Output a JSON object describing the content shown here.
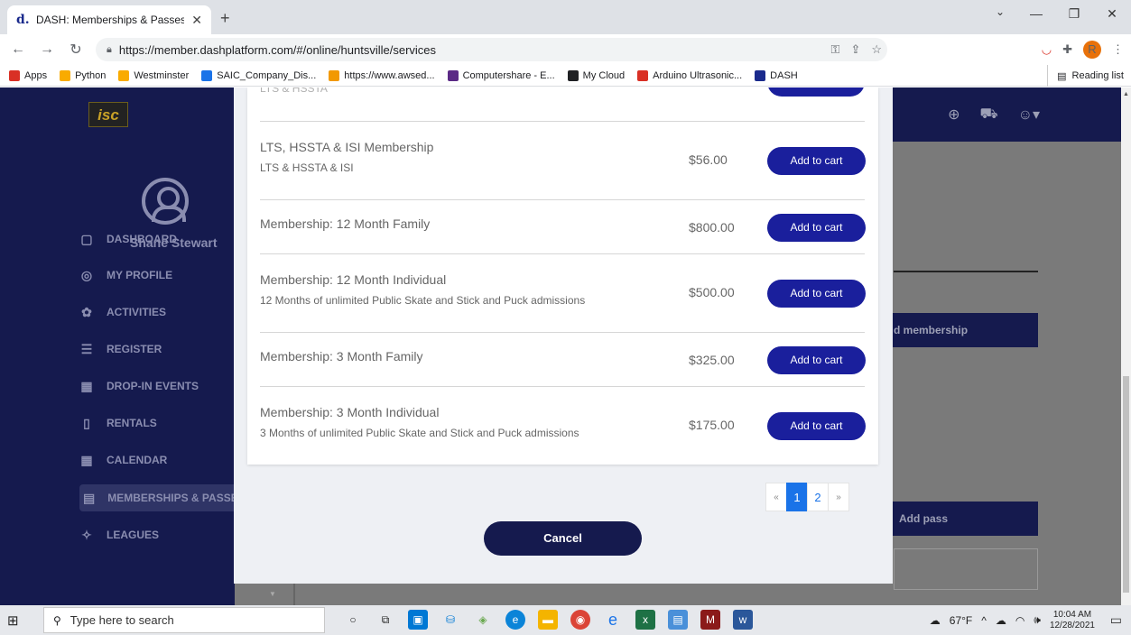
{
  "browser": {
    "tab_title": "DASH: Memberships & Passes",
    "url": "https://member.dashplatform.com/#/online/huntsville/services",
    "profile_initial": "R",
    "bookmarks": [
      {
        "label": "Apps",
        "color": "#d93025"
      },
      {
        "label": "Python",
        "color": "#f9ab00"
      },
      {
        "label": "Westminster",
        "color": "#f9ab00"
      },
      {
        "label": "SAIC_Company_Dis...",
        "color": "#1a73e8"
      },
      {
        "label": "https://www.awsed...",
        "color": "#f29900"
      },
      {
        "label": "Computershare - E...",
        "color": "#5b2a86"
      },
      {
        "label": "My Cloud",
        "color": "#202124"
      },
      {
        "label": "Arduino Ultrasonic...",
        "color": "#d93025"
      },
      {
        "label": "DASH",
        "color": "#1a2a8c"
      }
    ],
    "reading_list": "Reading list"
  },
  "app": {
    "logo": "isc",
    "user_name": "Shane Stewart",
    "menu": [
      {
        "label": "DASHBOARD",
        "icon": "▢"
      },
      {
        "label": "MY PROFILE",
        "icon": "◎"
      },
      {
        "label": "ACTIVITIES",
        "icon": "✿"
      },
      {
        "label": "REGISTER",
        "icon": "☰"
      },
      {
        "label": "DROP-IN EVENTS",
        "icon": "▦"
      },
      {
        "label": "RENTALS",
        "icon": "▯"
      },
      {
        "label": "CALENDAR",
        "icon": "▦"
      },
      {
        "label": "MEMBERSHIPS & PASSES",
        "icon": "▤"
      },
      {
        "label": "LEAGUES",
        "icon": "✧"
      }
    ],
    "bg_membership_btn": "d membership",
    "bg_pass_btn": "Add pass"
  },
  "modal": {
    "partial_top": "LTS & HSSTA",
    "items": [
      {
        "name": "LTS, HSSTA & ISI Membership",
        "desc": "LTS & HSSTA & ISI",
        "price": "$56.00",
        "button": "Add to cart"
      },
      {
        "name": "Membership: 12 Month Family",
        "desc": "",
        "price": "$800.00",
        "button": "Add to cart"
      },
      {
        "name": "Membership: 12 Month Individual",
        "desc": "12 Months of unlimited Public Skate and Stick and Puck admissions",
        "price": "$500.00",
        "button": "Add to cart"
      },
      {
        "name": "Membership: 3 Month Family",
        "desc": "",
        "price": "$325.00",
        "button": "Add to cart"
      },
      {
        "name": "Membership: 3 Month Individual",
        "desc": "3 Months of unlimited Public Skate and Stick and Puck admissions",
        "price": "$175.00",
        "button": "Add to cart"
      }
    ],
    "pagination": {
      "prev": "«",
      "pages": [
        "1",
        "2"
      ],
      "next": "»",
      "current": "1"
    },
    "cancel": "Cancel"
  },
  "taskbar": {
    "search_placeholder": "Type here to search",
    "weather": "67°F",
    "time": "10:04 AM",
    "date": "12/28/2021"
  }
}
